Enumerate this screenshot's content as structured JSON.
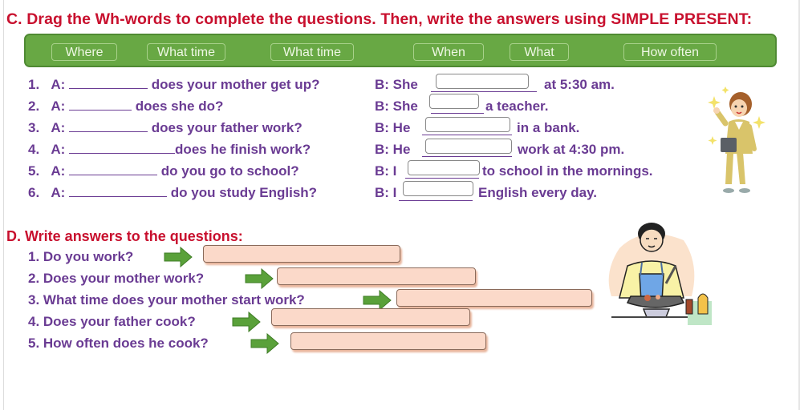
{
  "section_c": {
    "title": "C. Drag the Wh-words to complete the questions. Then, write the answers using SIMPLE PRESENT:",
    "word_bank": [
      "Where",
      "What time",
      "What time",
      "When",
      "What",
      "How often"
    ],
    "questions": [
      {
        "num": "1.",
        "a_label": "A:",
        "a_text": "does your mother get up?",
        "b_label": "B: She",
        "b_text": "at 5:30 am."
      },
      {
        "num": "2.",
        "a_label": "A:",
        "a_text": "does she do?",
        "b_label": "B: She",
        "b_text": "a teacher."
      },
      {
        "num": "3.",
        "a_label": "A:",
        "a_text": "does your father work?",
        "b_label": "B: He",
        "b_text": "in a bank."
      },
      {
        "num": "4.",
        "a_label": "A:",
        "a_text": "does he finish work?",
        "b_label": "B: He",
        "b_text": "work at 4:30 pm."
      },
      {
        "num": "5.",
        "a_label": "A:",
        "a_text": "do you go to school?",
        "b_label": "B: I",
        "b_text": "to school in the mornings."
      },
      {
        "num": "6.",
        "a_label": "A:",
        "a_text": "do you study English?",
        "b_label": "B: I",
        "b_text": "English every day."
      }
    ],
    "answer_values": [
      "",
      "",
      "",
      "",
      "",
      ""
    ],
    "illustration": "businesswoman-illustration"
  },
  "section_d": {
    "title": "D. Write answers to the questions:",
    "questions": [
      {
        "text": "1. Do you work?",
        "answer": ""
      },
      {
        "text": "2. Does your mother work?",
        "answer": ""
      },
      {
        "text": "3. What time does your mother start work?",
        "answer": ""
      },
      {
        "text": "4. Does your father cook?",
        "answer": ""
      },
      {
        "text": "5. How often does he cook?",
        "answer": ""
      }
    ],
    "illustration": "man-cooking-illustration"
  },
  "colors": {
    "title_red": "#c8102e",
    "text_purple": "#6a3b93",
    "bank_green": "#68a844",
    "answer_box": "#fbd9c9",
    "arrow_green": "#5aa13a"
  }
}
